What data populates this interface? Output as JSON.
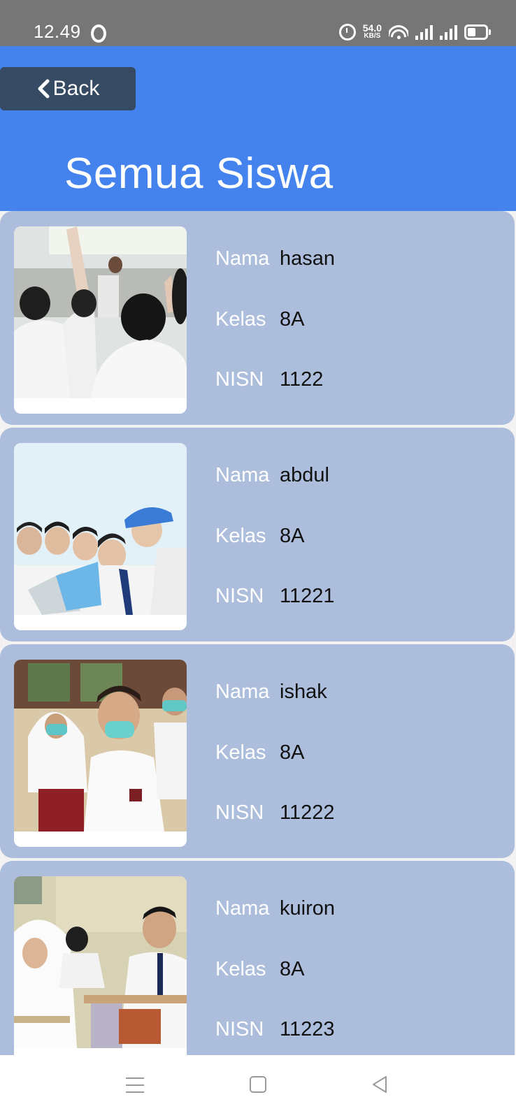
{
  "status_bar": {
    "time": "12.49",
    "net_speed_value": "54.0",
    "net_speed_unit": "KB/S",
    "icons": [
      "opera-icon",
      "alarm-icon",
      "wifi-icon",
      "signal-icon",
      "signal-icon",
      "battery-icon"
    ]
  },
  "header": {
    "back_label": "Back",
    "title": "Semua Siswa",
    "colors": {
      "header_bg": "#4483ed",
      "back_bg": "#364a63",
      "card_bg": "#adbedd"
    }
  },
  "labels": {
    "name": "Nama",
    "class": "Kelas",
    "nisn": "NISN"
  },
  "students": [
    {
      "name": "hasan",
      "class": "8A",
      "nisn": "1122",
      "image": "classroom-raising-hands-photo"
    },
    {
      "name": "abdul",
      "class": "8A",
      "nisn": "11221",
      "image": "students-reading-illustration"
    },
    {
      "name": "ishak",
      "class": "8A",
      "nisn": "11222",
      "image": "masked-students-photo"
    },
    {
      "name": "kuiron",
      "class": "8A",
      "nisn": "11223",
      "image": "students-writing-exam-photo"
    }
  ],
  "nav_bar": {
    "icons": [
      "menu-icon",
      "home-icon",
      "back-triangle-icon"
    ]
  }
}
